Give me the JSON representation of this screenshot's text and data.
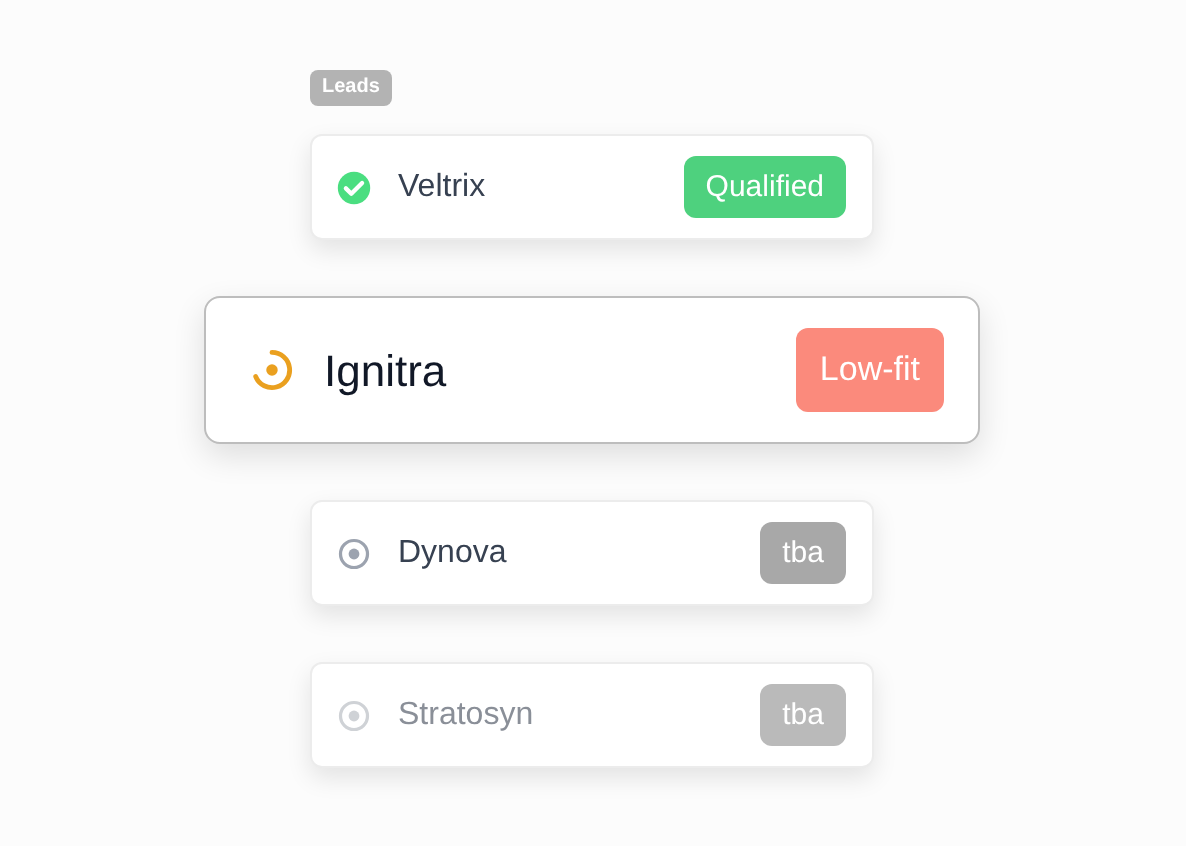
{
  "section_label": "Leads",
  "leads": [
    {
      "name": "Veltrix",
      "kind": "qualified",
      "badge": "Qualified",
      "selected": false,
      "disabled": false
    },
    {
      "name": "Ignitra",
      "kind": "progress",
      "badge": "Low-fit",
      "selected": true,
      "disabled": false
    },
    {
      "name": "Dynova",
      "kind": "pending",
      "badge": "tba",
      "selected": false,
      "disabled": false
    },
    {
      "name": "Stratosyn",
      "kind": "pending",
      "badge": "tba",
      "selected": false,
      "disabled": true
    }
  ]
}
